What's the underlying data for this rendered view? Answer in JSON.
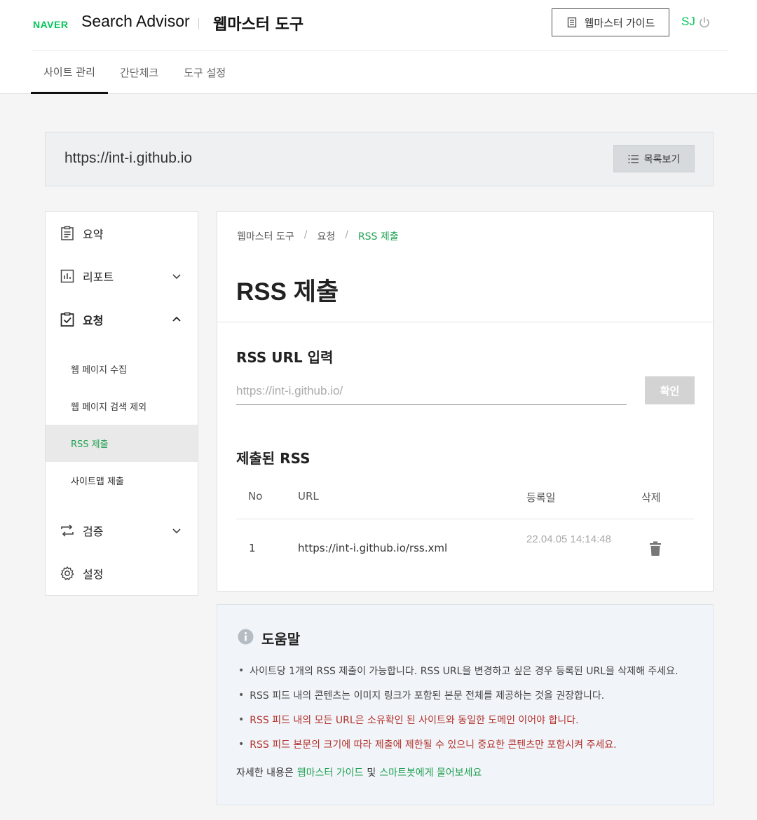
{
  "header": {
    "naver_logo": "NAVER",
    "product_name": "Search Advisor",
    "tool_name": "웹마스터 도구",
    "guide_button": "웹마스터 가이드",
    "user_initials": "SJ",
    "tabs": [
      {
        "label": "사이트 관리",
        "active": true
      },
      {
        "label": "간단체크",
        "active": false
      },
      {
        "label": "도구 설정",
        "active": false
      }
    ]
  },
  "site": {
    "url": "https://int-i.github.io",
    "list_button": "목록보기"
  },
  "sidebar": {
    "items": [
      {
        "label": "요약",
        "icon": "clipboard-icon"
      },
      {
        "label": "리포트",
        "icon": "chart-icon"
      },
      {
        "label": "요청",
        "icon": "clipboard-check-icon"
      },
      {
        "label": "검증",
        "icon": "repeat-icon"
      },
      {
        "label": "설정",
        "icon": "gear-icon"
      }
    ],
    "sub_items": [
      {
        "label": "웹 페이지 수집"
      },
      {
        "label": "웹 페이지 검색 제외"
      },
      {
        "label": "RSS 제출",
        "active": true
      },
      {
        "label": "사이트맵 제출"
      }
    ]
  },
  "breadcrumb": [
    "웹마스터 도구",
    "요청",
    "RSS 제출"
  ],
  "main": {
    "title": "RSS 제출",
    "input_section_title": "RSS URL 입력",
    "input_placeholder": "https://int-i.github.io/",
    "confirm_button": "확인",
    "submitted_title": "제출된 RSS",
    "table": {
      "headers": [
        "No",
        "URL",
        "등록일",
        "삭제"
      ],
      "rows": [
        {
          "no": "1",
          "url": "https://int-i.github.io/rss.xml",
          "date": "22.04.05 14:14:48"
        }
      ]
    }
  },
  "help": {
    "title": "도움말",
    "items": [
      {
        "text": "사이트당 1개의 RSS 제출이 가능합니다. RSS URL을 변경하고 싶은 경우 등록된 URL을 삭제해 주세요.",
        "warn": false
      },
      {
        "text": "RSS 피드 내의 콘텐츠는 이미지 링크가 포함된 본문 전체를 제공하는 것을 권장합니다.",
        "warn": false
      },
      {
        "text": "RSS 피드 내의 모든 URL은 소유확인 된 사이트와 동일한 도메인 이어야 합니다.",
        "warn": true
      },
      {
        "text": "RSS 피드 본문의 크기에 따라 제출에 제한될 수 있으니 중요한 콘텐츠만 포함시켜 주세요.",
        "warn": true
      }
    ],
    "footer_prefix": "자세한 내용은",
    "footer_link1": "웹마스터 가이드",
    "footer_and": "및",
    "footer_link2": "스마트봇에게 물어보세요"
  },
  "colors": {
    "accent_green": "#03c75a",
    "warn_red": "#b3302a"
  }
}
